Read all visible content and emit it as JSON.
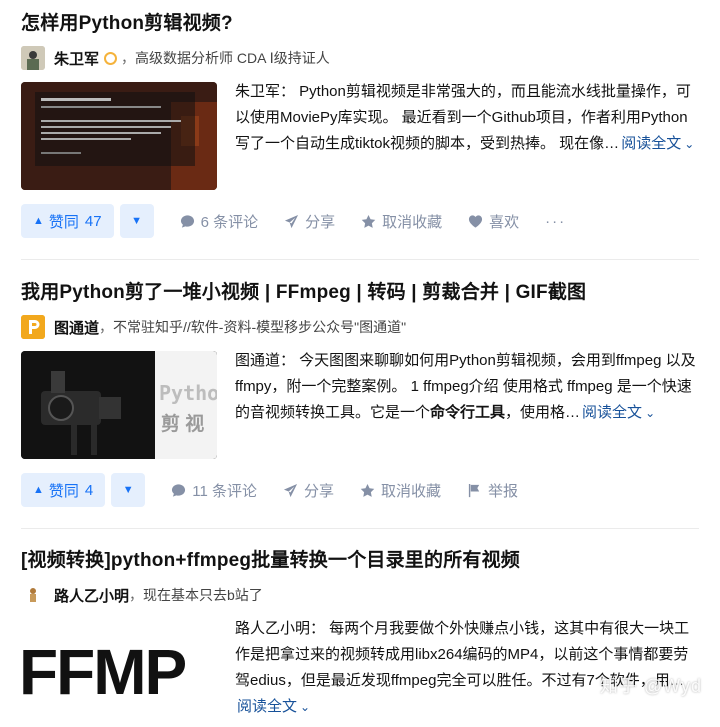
{
  "cards": [
    {
      "title": "怎样用Python剪辑视频?",
      "author": {
        "name": "朱卫军",
        "separator": "，",
        "bio": "高级数据分析师 CDA Ⅰ级持证人"
      },
      "thumbnail_icon": "text-post-screenshot",
      "excerpt": "朱卫军： Python剪辑视频是非常强大的，而且能流水线批量操作，可以使用MoviePy库实现。 最近看到一个Github项目，作者利用Python写了一个自动生成tiktok视频的脚本，受到热捧。 现在像…",
      "read_more": "阅读全文",
      "vote": {
        "label": "赞同",
        "count": "47"
      },
      "actions": [
        {
          "icon": "comment-icon",
          "label": "6 条评论"
        },
        {
          "icon": "share-icon",
          "label": "分享"
        },
        {
          "icon": "star-icon",
          "label": "取消收藏"
        },
        {
          "icon": "heart-icon",
          "label": "喜欢"
        }
      ],
      "more": "···"
    },
    {
      "title": "我用Python剪了一堆小视频 | FFmpeg | 转码 | 剪裁合并 | GIF截图",
      "author": {
        "name": "图通道",
        "separator": "，",
        "bio": "不常驻知乎//软件-资料-模型移步公众号\"图通道\""
      },
      "thumbnail_text": [
        "Pytho",
        "剪 视"
      ],
      "excerpt_parts": [
        "图通道： 今天图图来聊聊如何用Python剪辑视频，会用到ffmpeg 以及 ffmpy，附一个完整案例。 1 ffmpeg介绍 使用格式 ffmpeg 是一个快速的音视频转换工具。它是一个",
        "命令行工具",
        "，使用格…"
      ],
      "read_more": "阅读全文",
      "vote": {
        "label": "赞同",
        "count": "4"
      },
      "actions": [
        {
          "icon": "comment-icon",
          "label": "11 条评论"
        },
        {
          "icon": "share-icon",
          "label": "分享"
        },
        {
          "icon": "star-icon",
          "label": "取消收藏"
        },
        {
          "icon": "flag-icon",
          "label": "举报"
        }
      ]
    },
    {
      "title": "[视频转换]python+ffmpeg批量转换一个目录里的所有视频",
      "author": {
        "name": "路人乙小明",
        "separator": "，",
        "bio": "现在基本只去b站了"
      },
      "thumbnail_text": "FFMP",
      "excerpt": "路人乙小明： 每两个月我要做个外快赚点小钱，这其中有很大一块工作是把拿过来的视频转成用libx264编码的MP4，以前这个事情都要劳驾edius，但是最近发现ffmpeg完全可以胜任。不过有7个软件，用…",
      "read_more": "阅读全文"
    }
  ],
  "watermark": "知乎 @Wyd"
}
